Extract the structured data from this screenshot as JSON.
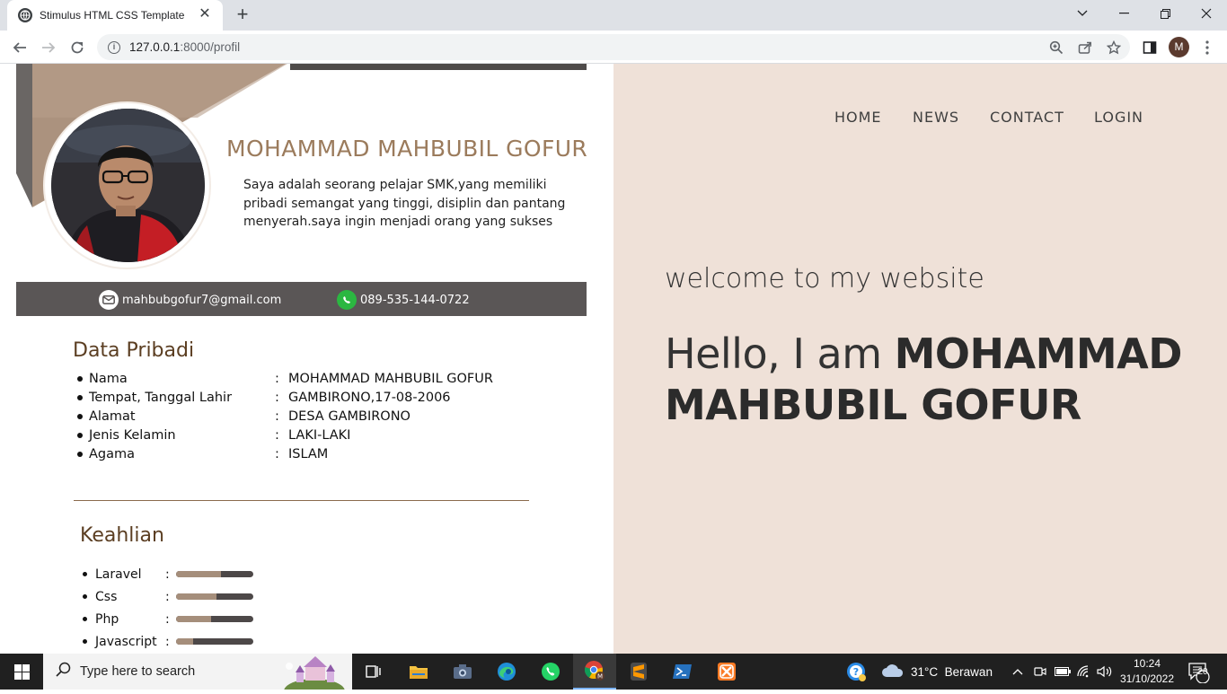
{
  "browser": {
    "tab_title": "Stimulus HTML CSS Template",
    "tab_close": "✕",
    "new_tab": "+",
    "url_host": "127.0.0.1",
    "url_rest": ":8000/profil",
    "profile_initial": "M"
  },
  "cv": {
    "name": "MOHAMMAD MAHBUBIL GOFUR",
    "bio": "Saya adalah seorang pelajar SMK,yang  memiliki pribadi semangat yang tinggi, disiplin dan pantang menyerah.saya ingin menjadi orang yang sukses",
    "email": "mahbubgofur7@gmail.com",
    "phone": "089-535-144-0722",
    "personal_title": "Data Pribadi",
    "personal": [
      {
        "key": "Nama",
        "value": "MOHAMMAD MAHBUBIL GOFUR"
      },
      {
        "key": "Tempat, Tanggal Lahir",
        "value": "GAMBIRONO,17-08-2006"
      },
      {
        "key": "Alamat",
        "value": "DESA GAMBIRONO"
      },
      {
        "key": "Jenis Kelamin",
        "value": "LAKI-LAKI"
      },
      {
        "key": "Agama",
        "value": "ISLAM"
      }
    ],
    "skills_title": "Keahlian",
    "skills": [
      {
        "name": "Laravel",
        "level": 0.58
      },
      {
        "name": "Css",
        "level": 0.52
      },
      {
        "name": "Php",
        "level": 0.45
      },
      {
        "name": "Javascript",
        "level": 0.22
      }
    ],
    "colon": ":"
  },
  "hero": {
    "nav": [
      "HOME",
      "NEWS",
      "CONTACT",
      "LOGIN"
    ],
    "welcome": "welcome to my website",
    "hello_prefix": "Hello, I am ",
    "hello_name": "MOHAMMAD MAHBUBIL GOFUR"
  },
  "taskbar": {
    "search_placeholder": "Type here to search",
    "weather": "31°C  Berawan",
    "time": "10:24",
    "date": "31/10/2022",
    "notifications": "20"
  },
  "colors": {
    "hero_bg": "#efe1d8",
    "accent_brown": "#9b7b5c",
    "contact_bar": "#5a5656"
  }
}
